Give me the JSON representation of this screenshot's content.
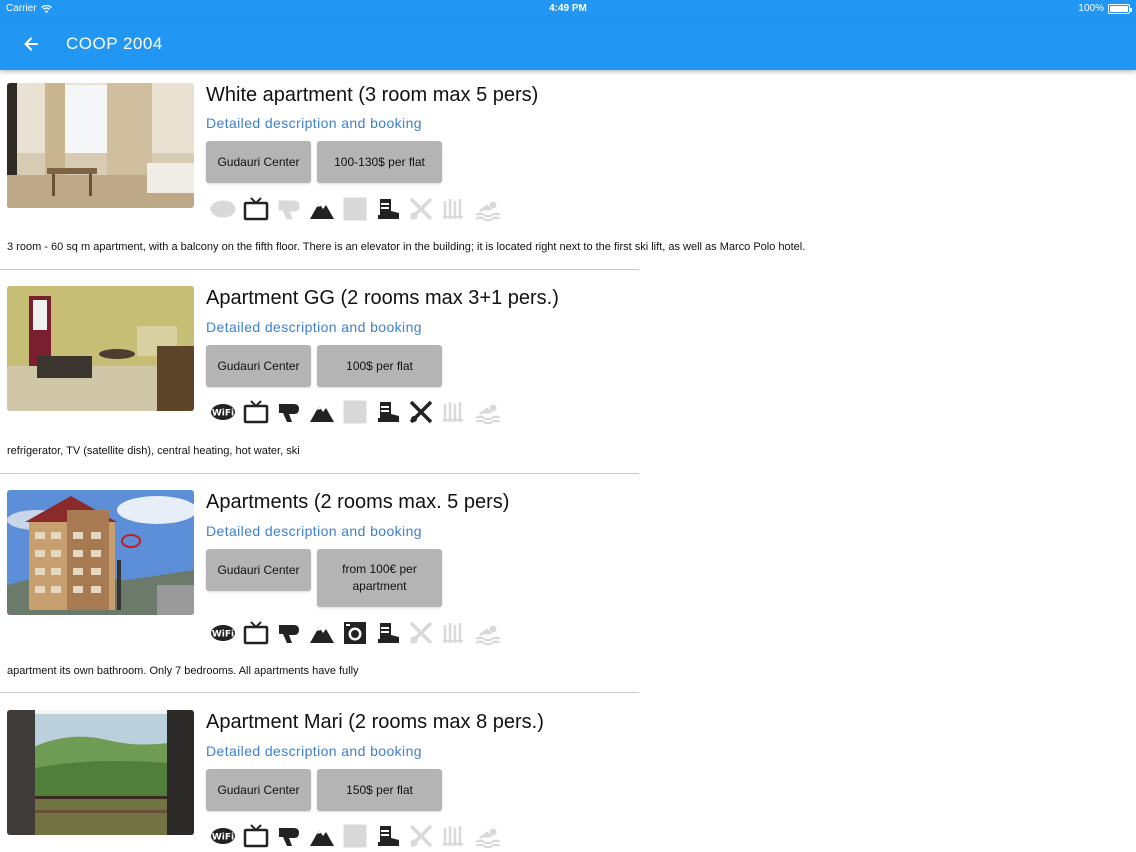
{
  "status": {
    "carrier": "Carrier",
    "time": "4:49 PM",
    "battery": "100%",
    "battery_level": 1.0
  },
  "appbar": {
    "title": "COOP 2004",
    "back_icon": "arrow-left-icon"
  },
  "colors": {
    "primary": "#2196f3",
    "link": "#3d7fd0",
    "chip": "#b4b4b4",
    "icon_on": "#222222",
    "icon_off": "#d9d9d9"
  },
  "listings": [
    {
      "title": "White apartment (3 room max 5 pers)",
      "link": "Detailed description and booking",
      "location": "Gudauri Center",
      "price": "100-130$ per flat",
      "amenities": {
        "wifi": false,
        "tv": true,
        "hairdryer": false,
        "mountain": true,
        "washer": false,
        "ski-boot": true,
        "ski-equipment": false,
        "heating": false,
        "pool": false
      },
      "description": "3 room - 60 sq m apartment, with a balcony on the fifth floor. There is an elevator in the building; it is located right next to the first ski lift, as well as Marco Polo hotel."
    },
    {
      "title": "Apartment GG (2 rooms max 3+1 pers.)",
      "link": "Detailed description and booking",
      "location": "Gudauri Center",
      "price": "100$ per flat",
      "amenities": {
        "wifi": true,
        "tv": true,
        "hairdryer": true,
        "mountain": true,
        "washer": false,
        "ski-boot": true,
        "ski-equipment": true,
        "heating": false,
        "pool": false
      },
      "description": "refrigerator, TV (satellite dish), central heating, hot water, ski"
    },
    {
      "title": "Apartments (2 rooms max. 5 pers)",
      "link": "Detailed description and booking",
      "location": "Gudauri Center",
      "price": "from 100€ per apartment",
      "amenities": {
        "wifi": true,
        "tv": true,
        "hairdryer": true,
        "mountain": true,
        "washer": true,
        "ski-boot": true,
        "ski-equipment": false,
        "heating": false,
        "pool": false
      },
      "description": "apartment its own bathroom. Only 7 bedrooms. All apartments have fully"
    },
    {
      "title": "Apartment Mari (2 rooms max 8 pers.)",
      "link": "Detailed description and booking",
      "location": "Gudauri Center",
      "price": "150$ per flat",
      "amenities": {
        "wifi": true,
        "tv": true,
        "hairdryer": true,
        "mountain": true,
        "washer": false,
        "ski-boot": true,
        "ski-equipment": false,
        "heating": false,
        "pool": false
      },
      "description": ""
    }
  ]
}
